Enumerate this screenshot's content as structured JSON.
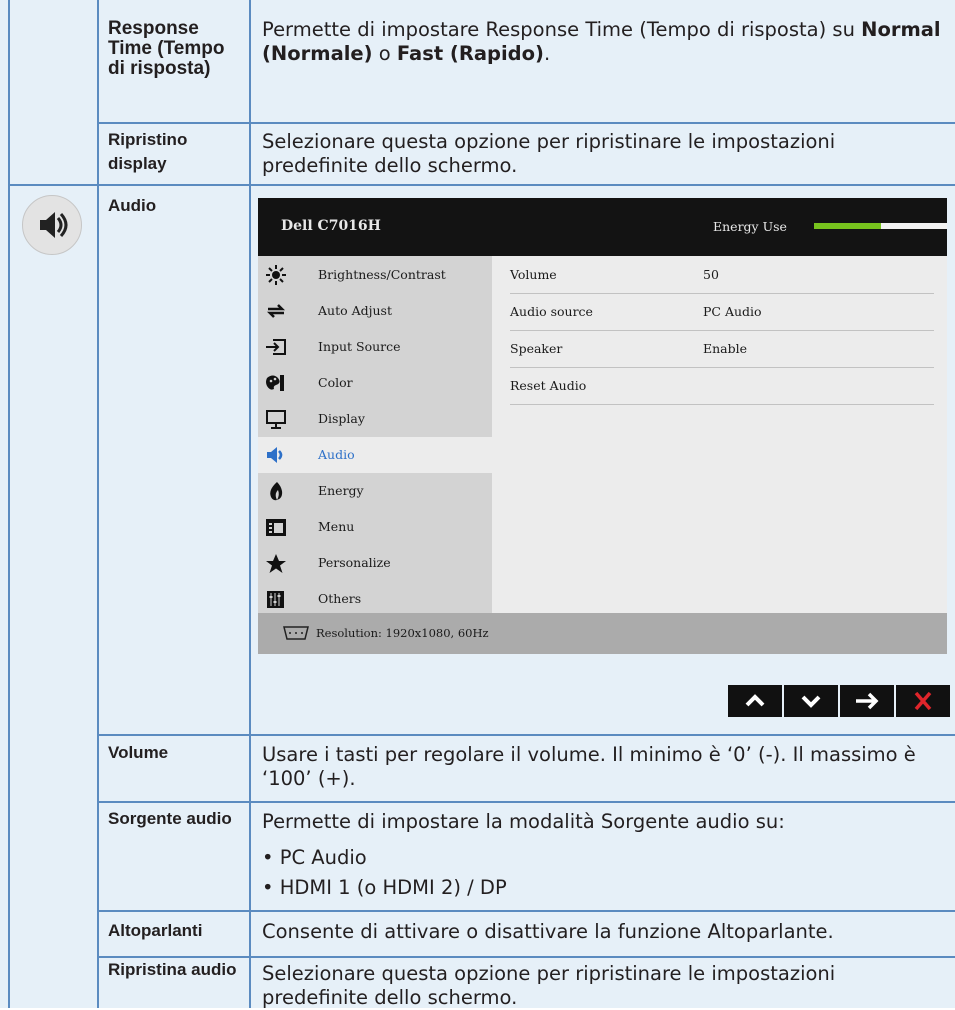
{
  "rows": [
    {
      "label": "Response Time (Tempo di risposta)",
      "desc_pre": "Permette di impostare Response Time (Tempo di risposta) su ",
      "opt1": "Normal (Normale)",
      "mid": " o ",
      "opt2": "Fast (Rapido)",
      "end": "."
    },
    {
      "label": "Ripristino display",
      "desc": "Selezionare questa opzione per ripristinare le impostazioni predefinite dello schermo."
    },
    {
      "label": "Audio",
      "icon": "speaker-icon"
    },
    {
      "label": "Volume",
      "desc": "Usare i tasti per regolare il volume. Il minimo è ‘0’ (-). Il massimo è ‘100’ (+)."
    },
    {
      "label": "Sorgente audio",
      "desc": "Permette di impostare la modalità Sorgente audio su:",
      "bullets": [
        "• PC Audio",
        "• HDMI 1 (o HDMI 2) / DP"
      ]
    },
    {
      "label": "Altoparlanti",
      "desc": "Consente di attivare o disattivare la funzione Altoparlante."
    },
    {
      "label": "Ripristina audio",
      "desc": "Selezionare questa opzione per ripristinare le impostazioni predefinite dello schermo."
    }
  ],
  "osd": {
    "title": "Dell C7016H",
    "energy_label": "Energy Use",
    "energy_level": 0.5,
    "menu": [
      {
        "label": "Brightness/Contrast",
        "icon": "brightness-icon"
      },
      {
        "label": "Auto Adjust",
        "icon": "auto-adjust-icon"
      },
      {
        "label": "Input Source",
        "icon": "input-source-icon"
      },
      {
        "label": "Color",
        "icon": "color-icon"
      },
      {
        "label": "Display",
        "icon": "display-icon"
      },
      {
        "label": "Audio",
        "icon": "speaker-icon",
        "selected": true
      },
      {
        "label": "Energy",
        "icon": "energy-icon"
      },
      {
        "label": "Menu",
        "icon": "menu-icon"
      },
      {
        "label": "Personalize",
        "icon": "star-icon"
      },
      {
        "label": "Others",
        "icon": "others-icon"
      }
    ],
    "settings": [
      {
        "name": "Volume",
        "value": "50"
      },
      {
        "name": "Audio source",
        "value": "PC Audio"
      },
      {
        "name": "Speaker",
        "value": "Enable"
      },
      {
        "name": "Reset Audio",
        "value": ""
      }
    ],
    "footer": "Resolution: 1920x1080, 60Hz",
    "nav_buttons": [
      {
        "icon": "chevron-up-icon"
      },
      {
        "icon": "chevron-down-icon"
      },
      {
        "icon": "arrow-right-icon"
      },
      {
        "icon": "close-icon"
      }
    ],
    "colors": {
      "header": "#131313",
      "energy_fill": "#78c31e",
      "selected_text": "#2d70c8",
      "close": "#e0252b"
    }
  }
}
